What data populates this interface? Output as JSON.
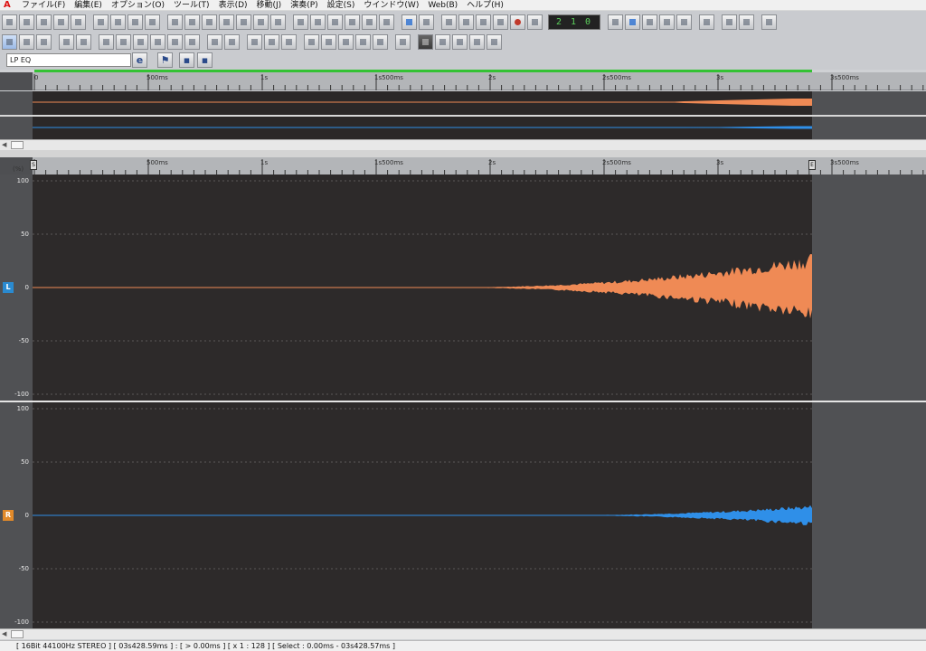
{
  "menu": {
    "items": [
      "ファイル(F)",
      "編集(E)",
      "オプション(O)",
      "ツール(T)",
      "表示(D)",
      "移動(J)",
      "演奏(P)",
      "設定(S)",
      "ウインドウ(W)",
      "Web(B)",
      "ヘルプ(H)"
    ]
  },
  "transport": {
    "counter": "2 1 0"
  },
  "preset": {
    "name": "LP EQ"
  },
  "ruler": {
    "labels": [
      "0",
      "500ms",
      "1s",
      "1s500ms",
      "2s",
      "2s500ms",
      "3s",
      "3s500ms"
    ],
    "start_marker": "S",
    "end_marker": "E",
    "unit": "(%)"
  },
  "channels": {
    "left": {
      "badge": "L",
      "color": "#ef8a55"
    },
    "right": {
      "badge": "R",
      "color": "#2f8fe8"
    },
    "y_labels": [
      "100",
      "50",
      "0",
      "-50",
      "-100"
    ]
  },
  "status": {
    "text": "[ 16Bit  44100Hz  STEREO ] [ 03s428.59ms ] : [ > 0.00ms ] [ x 1 : 128 ] [ Select : 0.00ms - 03s428.57ms ]"
  }
}
